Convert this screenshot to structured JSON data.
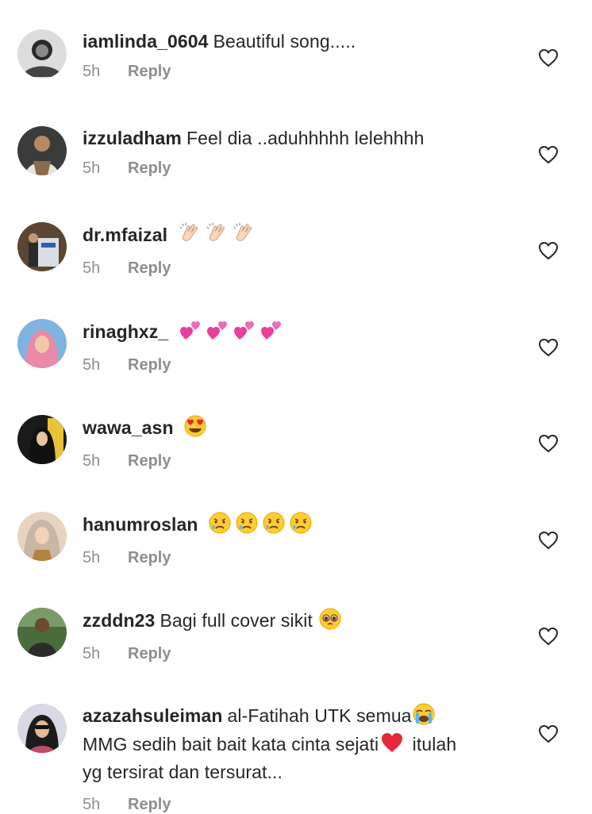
{
  "comments": [
    {
      "username": "iamlinda_0604",
      "text": "Beautiful song.....",
      "emoji": [],
      "time": "5h",
      "reply": "Reply",
      "avatar_colors": [
        "#2a2a2a",
        "#6b6b6b"
      ]
    },
    {
      "username": "izzuladham",
      "text": "Feel dia ..aduhhhhh lelehhhh",
      "emoji": [],
      "time": "5h",
      "reply": "Reply",
      "avatar_colors": [
        "#3b3b3b",
        "#c9b08f"
      ]
    },
    {
      "username": "dr.mfaizal",
      "text": "",
      "emoji": [
        "clapping-hands-emoji",
        "clapping-hands-emoji",
        "clapping-hands-emoji"
      ],
      "time": "5h",
      "reply": "Reply",
      "avatar_colors": [
        "#5a4632",
        "#d9dde4"
      ]
    },
    {
      "username": "rinaghxz_",
      "text": "",
      "emoji": [
        "two-hearts-emoji",
        "two-hearts-emoji",
        "two-hearts-emoji",
        "two-hearts-emoji"
      ],
      "time": "5h",
      "reply": "Reply",
      "avatar_colors": [
        "#7fb3e0",
        "#e88aa8"
      ]
    },
    {
      "username": "wawa_asn",
      "text": "",
      "emoji": [
        "heart-eyes-emoji"
      ],
      "time": "5h",
      "reply": "Reply",
      "avatar_colors": [
        "#1a1a1a",
        "#e8c23a"
      ]
    },
    {
      "username": "hanumroslan",
      "text": "",
      "emoji": [
        "crying-face-emoji",
        "crying-face-emoji",
        "crying-face-emoji",
        "crying-face-emoji"
      ],
      "time": "5h",
      "reply": "Reply",
      "avatar_colors": [
        "#c8b7a6",
        "#e8d2c0"
      ]
    },
    {
      "username": "zzddn23",
      "text": "Bagi full cover sikit",
      "emoji": [
        "pleading-face-emoji"
      ],
      "time": "5h",
      "reply": "Reply",
      "avatar_colors": [
        "#4a6b3c",
        "#2b2b2b"
      ]
    },
    {
      "username": "azazahsuleiman",
      "text": "al-Fatihah UTK semua",
      "emoji_after_text": [
        "loudly-crying-face-emoji"
      ],
      "text2": "MMG sedih bait bait kata cinta sejati",
      "emoji2": [
        "red-heart-emoji"
      ],
      "text3": "itulah yg tersirat dan tersurat...",
      "time": "5h",
      "reply": "Reply",
      "avatar_colors": [
        "#d9d9e6",
        "#1c1c1c"
      ]
    }
  ],
  "colors": {
    "primary_text": "#262626",
    "secondary_text": "#8e8e8e",
    "heart_outline": "#262626",
    "background": "#ffffff"
  },
  "icons": {
    "like": "heart-outline-icon"
  }
}
